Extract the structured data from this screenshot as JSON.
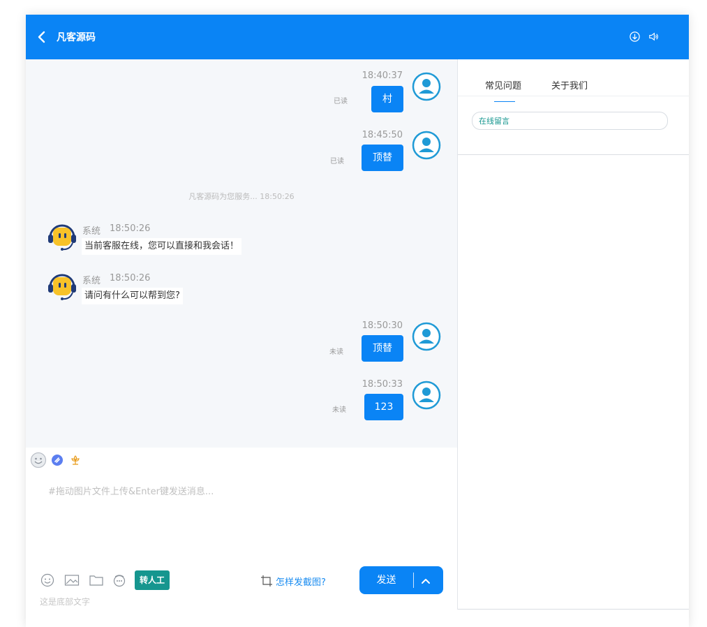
{
  "header": {
    "title": "凡客源码"
  },
  "messages": {
    "m1": {
      "time": "18:40:37",
      "text": "村",
      "status": "已读"
    },
    "m2": {
      "time": "18:45:50",
      "text": "顶替",
      "status": "已读"
    },
    "system_notice": "凡客源码为您服务...  18:50:26",
    "bot1": {
      "name": "系统",
      "time": "18:50:26",
      "text": "当前客服在线，您可以直接和我会话！"
    },
    "bot2": {
      "name": "系统",
      "time": "18:50:26",
      "text": "请问有什么可以帮到您?"
    },
    "m3": {
      "time": "18:50:30",
      "text": "顶替",
      "status": "未读"
    },
    "m4": {
      "time": "18:50:33",
      "text": "123",
      "status": "未读"
    }
  },
  "input": {
    "placeholder": "#拖动图片文件上传&Enter键发送消息..."
  },
  "toolbar": {
    "transfer_label": "转人工",
    "screenshot_help": "怎样发截图?",
    "send_label": "发送"
  },
  "footer": {
    "text": "这是底部文字"
  },
  "side": {
    "tabs": [
      {
        "label": "常见问题"
      },
      {
        "label": "关于我们"
      }
    ],
    "leave_message": "在线留言"
  },
  "colors": {
    "primary": "#0a84f5",
    "teal": "#16968f"
  }
}
